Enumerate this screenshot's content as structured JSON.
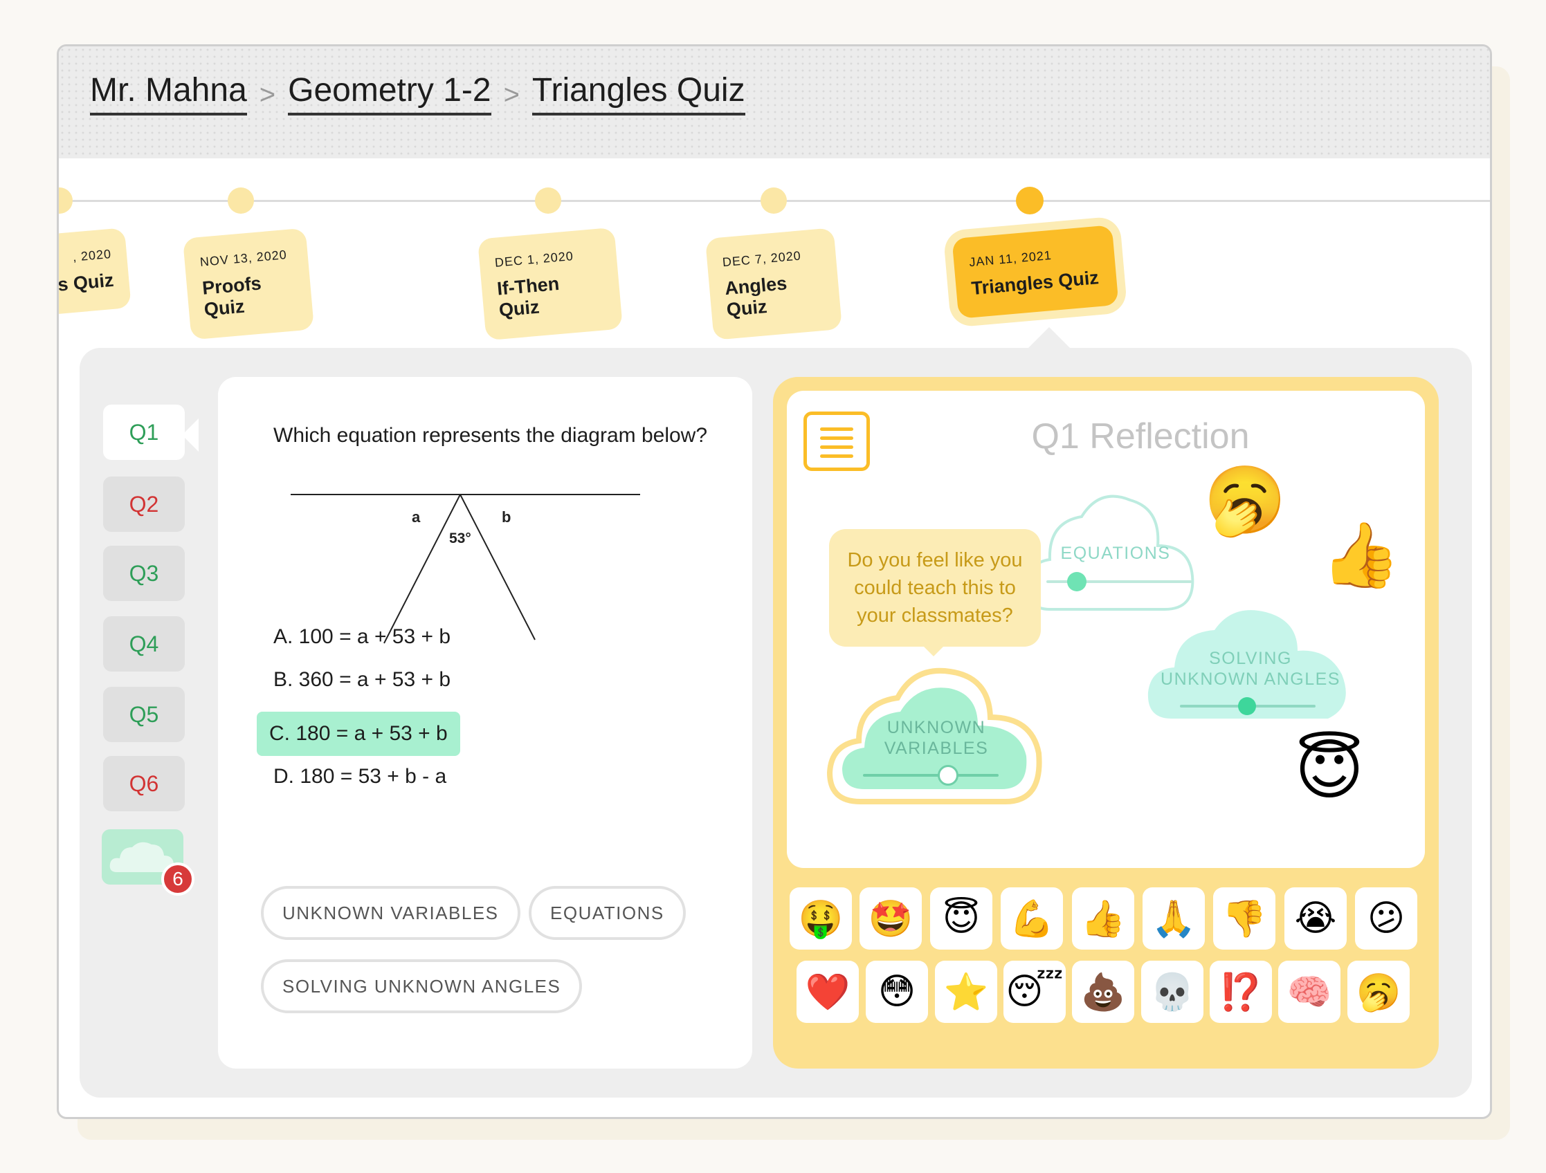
{
  "breadcrumb": [
    "Mr. Mahna",
    "Geometry 1-2",
    "Triangles Quiz"
  ],
  "breadcrumb_separator": ">",
  "timeline": [
    {
      "date": ", 2020",
      "name": "s Quiz"
    },
    {
      "date": "NOV 13, 2020",
      "name": "Proofs Quiz"
    },
    {
      "date": "DEC 1, 2020",
      "name": "If-Then Quiz"
    },
    {
      "date": "DEC 7, 2020",
      "name": "Angles Quiz"
    },
    {
      "date": "JAN 11, 2021",
      "name": "Triangles Quiz",
      "active": true
    }
  ],
  "questions": [
    {
      "label": "Q1",
      "status": "correct",
      "active": true
    },
    {
      "label": "Q2",
      "status": "incorrect"
    },
    {
      "label": "Q3",
      "status": "correct"
    },
    {
      "label": "Q4",
      "status": "correct"
    },
    {
      "label": "Q5",
      "status": "correct"
    },
    {
      "label": "Q6",
      "status": "incorrect"
    }
  ],
  "reflection_count": "6",
  "question": {
    "text": "Which equation represents the diagram below?",
    "diagram": {
      "label_a": "a",
      "label_b": "b",
      "angle": "53°"
    },
    "answers": [
      {
        "text": "A. 100 = a + 53 + b"
      },
      {
        "text": "B. 360 = a + 53 + b"
      },
      {
        "text": "C. 180 = a + 53 + b",
        "selected": true
      },
      {
        "text": "D. 180 = 53 + b - a"
      }
    ],
    "tags": [
      "UNKNOWN VARIABLES",
      "EQUATIONS",
      "SOLVING UNKNOWN ANGLES"
    ]
  },
  "reflection": {
    "title": "Q1 Reflection",
    "prompt": "Do you feel like you could teach this to your classmates?",
    "clouds": [
      {
        "line1": "EQUATIONS",
        "line2": "",
        "value": 0.2
      },
      {
        "line1": "SOLVING",
        "line2": "UNKNOWN ANGLES",
        "value": 0.5
      },
      {
        "line1": "UNKNOWN",
        "line2": "VARIABLES",
        "value": 0.6
      }
    ],
    "floating_emojis": [
      "yawning-face",
      "thumbs-up",
      "smiling-face-with-halo"
    ],
    "emoji_palette": [
      [
        "money-mouth-face",
        "star-struck",
        "smiling-face-with-halo",
        "flexed-biceps",
        "thumbs-up",
        "folded-hands",
        "thumbs-down",
        "loudly-crying-face",
        "confused-face"
      ],
      [
        "red-heart",
        "flushed-face",
        "star",
        "sleeping-face",
        "pile-of-poo",
        "skull",
        "interrobang",
        "brain",
        "yawning-face"
      ]
    ]
  },
  "colors": {
    "accent": "#fbbd27",
    "correct": "#2e9e58",
    "incorrect": "#d23434",
    "mint": "#a8f0d0"
  }
}
